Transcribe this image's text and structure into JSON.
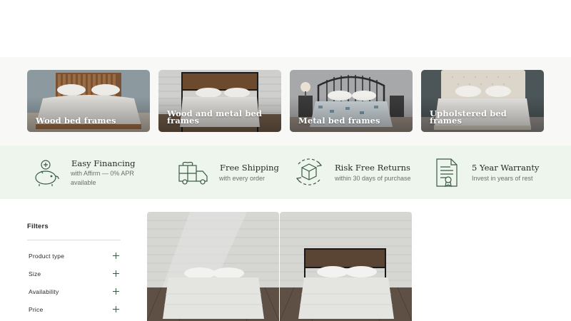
{
  "categories": [
    {
      "label": "Wood bed frames"
    },
    {
      "label": "Wood and metal bed frames"
    },
    {
      "label": "Metal bed frames"
    },
    {
      "label": "Upholstered bed frames"
    }
  ],
  "perks": [
    {
      "title": "Easy Financing",
      "subtitle": "with Affirm — 0% APR available",
      "icon": "piggy-bank-icon"
    },
    {
      "title": "Free Shipping",
      "subtitle": "with every order",
      "icon": "delivery-truck-icon"
    },
    {
      "title": "Risk Free Returns",
      "subtitle": "within 30 days of purchase",
      "icon": "return-box-icon"
    },
    {
      "title": "5 Year Warranty",
      "subtitle": "Invest in years of rest",
      "icon": "certificate-icon"
    }
  ],
  "filters": {
    "title": "Filters",
    "items": [
      {
        "label": "Product type"
      },
      {
        "label": "Size"
      },
      {
        "label": "Availability"
      },
      {
        "label": "Price"
      }
    ]
  },
  "colors": {
    "accent_green": "#3a5a44",
    "perks_background": "#eef5ec",
    "category_background": "#f8f8f7"
  }
}
